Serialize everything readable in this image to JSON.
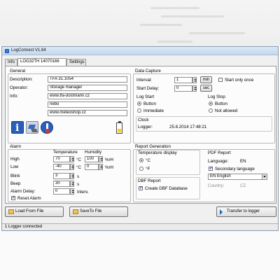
{
  "window": {
    "title": "LogConnect V1.84"
  },
  "tabs": [
    {
      "label": "Info"
    },
    {
      "label": "LOG32TH 14070166"
    },
    {
      "label": "Settings"
    }
  ],
  "general": {
    "title": "General",
    "description_label": "Description:",
    "description_value": "TFA 31.1054",
    "operator_label": "Operator:",
    "operator_value": "Storage manager",
    "info_label": "Info:",
    "info_lines": [
      "www.tfa-dostmann.cz",
      "nebo",
      "www.meteoshop.cz"
    ],
    "icons": [
      "info-icon",
      "network-icon",
      "thermometer-icon",
      "battery-icon"
    ],
    "battery_level": 0.45
  },
  "data_capture": {
    "title": "Data Capture",
    "interval_label": "Interval:",
    "interval_value": "1",
    "interval_unit": "min",
    "start_delay_label": "Start Delay:",
    "start_delay_value": "0",
    "start_delay_unit": "sec",
    "start_only_once_label": "Start only once",
    "start_only_once_checked": false,
    "log_start": {
      "title": "Log Start",
      "options": [
        "Button",
        "Immediate"
      ],
      "selected": "Button"
    },
    "log_stop": {
      "title": "Log Stop",
      "options": [
        "Button",
        "Not allowed"
      ],
      "selected": "Button"
    },
    "clock": {
      "title": "Clock",
      "logger_label": "Logger:",
      "logger_value": "25.8.2014 17:48:21"
    }
  },
  "alarm": {
    "title": "Alarm",
    "temperature_header": "Temperature",
    "humidity_header": "Humidity",
    "high_label": "High",
    "low_label": "Low",
    "high_temp": "70",
    "low_temp": "-40",
    "temp_unit": "°C",
    "high_hum": "100",
    "low_hum": "0",
    "hum_unit": "%rH",
    "blink_label": "Blink",
    "blink_value": "3",
    "blink_unit": "s",
    "beep_label": "Beep",
    "beep_value": "30",
    "beep_unit": "s",
    "alarm_delay_label": "Alarm Delay:",
    "alarm_delay_value": "0",
    "alarm_delay_unit": "Interv.",
    "reset_alarm_label": "Reset Alarm",
    "reset_alarm_checked": true
  },
  "report_generation": {
    "title": "Report Generation",
    "temperature_display": {
      "title": "Temperature display",
      "options": [
        "°C",
        "°F"
      ],
      "selected": "°C"
    },
    "dbf_report": {
      "title": "DBF Report",
      "create_label": "Create DBF Database",
      "create_checked": true
    },
    "pdf_report": {
      "title": "PDF Report",
      "language_label": "Language:",
      "language_value": "EN",
      "secondary_language_label": "Secondary language",
      "secondary_language_checked": true,
      "secondary_language_select": "EN  English",
      "country_label": "Country:",
      "country_value": "CZ"
    }
  },
  "buttons": {
    "load_from_file": "Load From File",
    "save_to_file": "SaveTo File",
    "transfer_to_logger": "Transfer to logger"
  },
  "status": {
    "text": "1 Logger connected"
  }
}
